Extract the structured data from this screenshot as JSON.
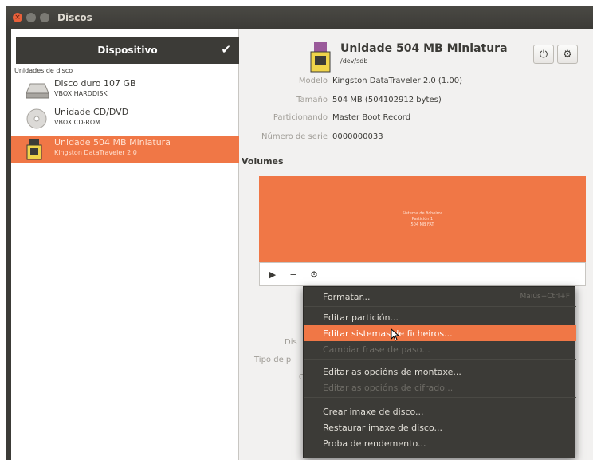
{
  "window": {
    "title": "Discos"
  },
  "sidebar": {
    "header": "Dispositivo",
    "section": "Unidades de disco",
    "drives": [
      {
        "name": "Disco duro 107 GB",
        "sub": "VBOX HARDDISK",
        "icon": "hard-disk-icon"
      },
      {
        "name": "Unidade CD/DVD",
        "sub": "VBOX CD-ROM",
        "icon": "cd-rom-icon"
      },
      {
        "name": "Unidade 504 MB Miniatura",
        "sub": "Kingston DataTraveler 2.0",
        "icon": "usb-drive-icon",
        "selected": true
      }
    ]
  },
  "device": {
    "title": "Unidade 504 MB Miniatura",
    "path": "/dev/sdb",
    "props": [
      {
        "label": "Modelo",
        "value": "Kingston DataTraveler 2.0 (1.00)"
      },
      {
        "label": "Tamaño",
        "value": "504 MB (504102912 bytes)"
      },
      {
        "label": "Particionando",
        "value": "Master Boot Record"
      },
      {
        "label": "Número de serie",
        "value": "0000000033"
      }
    ]
  },
  "volumes": {
    "heading": "Volumes",
    "partition_lines": [
      "Sistema de ficheiros",
      "Partición 1",
      "504 MB FAT"
    ]
  },
  "hidden_labels": {
    "dis": "Dis",
    "tipo": "Tipo de p",
    "c": "C"
  },
  "menu": {
    "items": [
      {
        "label": "Formatar...",
        "shortcut": "Maiús+Ctrl+F"
      },
      {
        "label": "Editar partición..."
      },
      {
        "label": "Editar sistemas de ficheiros...",
        "hover": true
      },
      {
        "label": "Cambiar frase de paso...",
        "disabled": true
      },
      {
        "label": "Editar as opcións de montaxe..."
      },
      {
        "label": "Editar as opcións de cifrado...",
        "disabled": true
      },
      {
        "label": "Crear imaxe de disco..."
      },
      {
        "label": "Restaurar imaxe de disco..."
      },
      {
        "label": "Proba de rendemento..."
      }
    ]
  },
  "colors": {
    "accent": "#f07746",
    "dark": "#3c3b37"
  }
}
